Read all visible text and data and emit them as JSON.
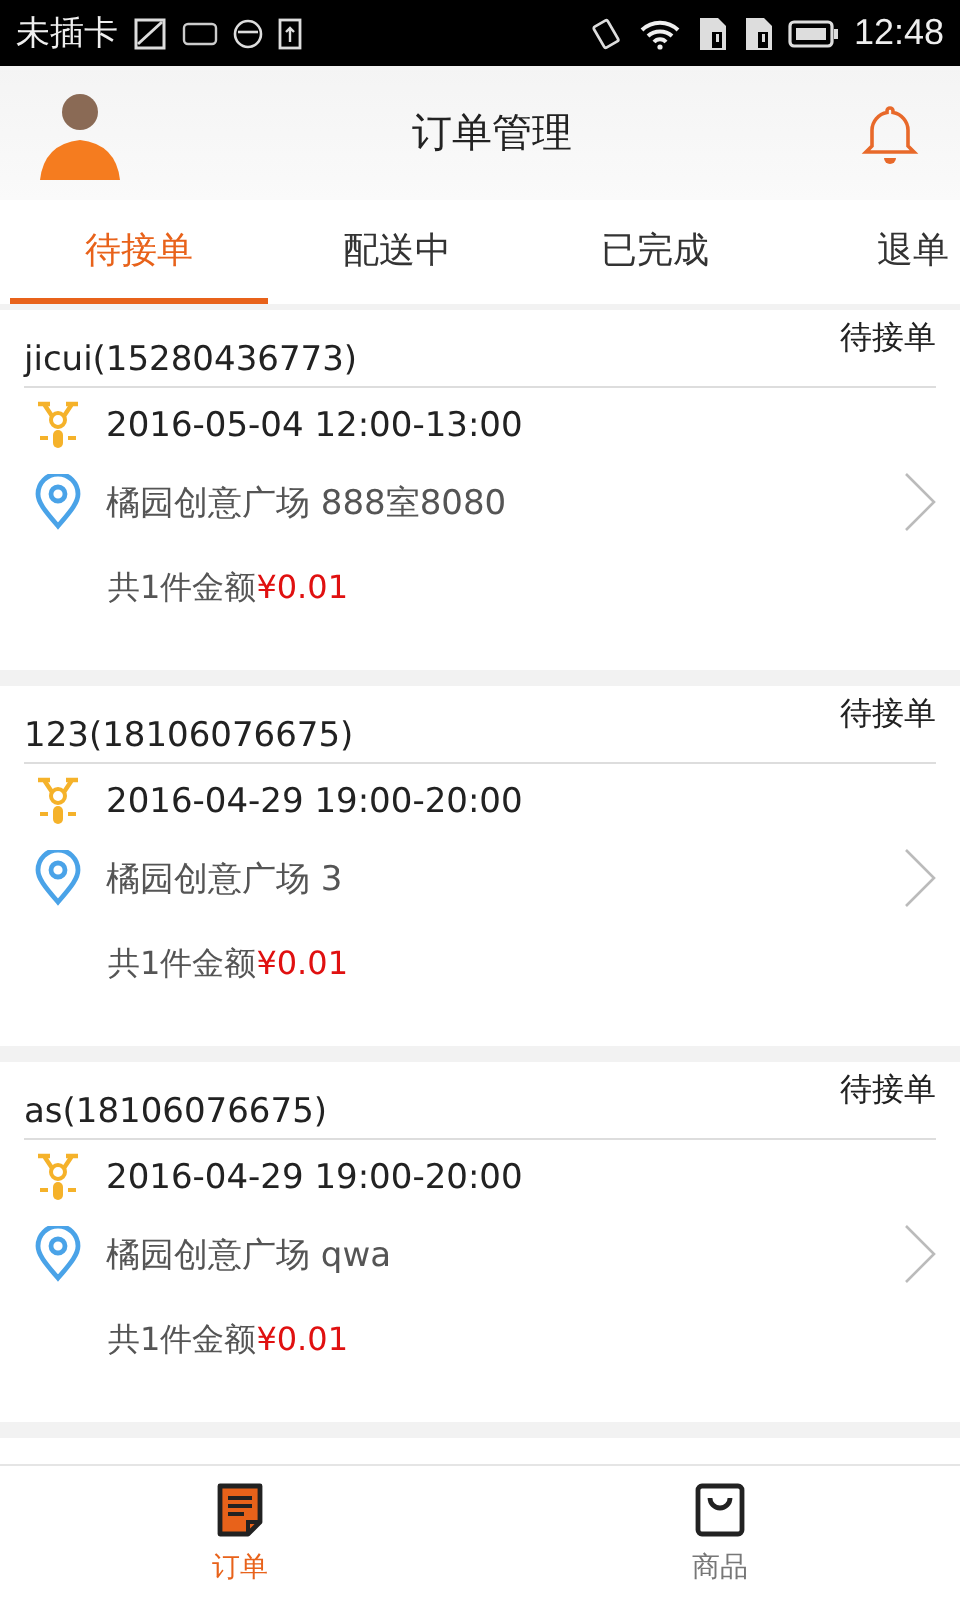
{
  "status_bar": {
    "carrier": "未插卡",
    "time": "12:48"
  },
  "header": {
    "title": "订单管理"
  },
  "tabs": [
    {
      "label": "待接单",
      "selected": true
    },
    {
      "label": "配送中",
      "selected": false
    },
    {
      "label": "已完成",
      "selected": false
    },
    {
      "label": "退单",
      "selected": false
    }
  ],
  "orders": [
    {
      "customer": "jicui(15280436773)",
      "status": "待接单",
      "time": "2016-05-04 12:00-13:00",
      "address": "橘园创意广场 888室8080",
      "total_label": "共1件金额",
      "amount": "¥0.01"
    },
    {
      "customer": "123(18106076675)",
      "status": "待接单",
      "time": "2016-04-29 19:00-20:00",
      "address": "橘园创意广场 3",
      "total_label": "共1件金额",
      "amount": "¥0.01"
    },
    {
      "customer": "as(18106076675)",
      "status": "待接单",
      "time": "2016-04-29 19:00-20:00",
      "address": "橘园创意广场 qwa",
      "total_label": "共1件金额",
      "amount": "¥0.01"
    }
  ],
  "bottom_nav": [
    {
      "label": "订单",
      "kind": "orders",
      "selected": true
    },
    {
      "label": "商品",
      "kind": "goods",
      "selected": false
    }
  ]
}
